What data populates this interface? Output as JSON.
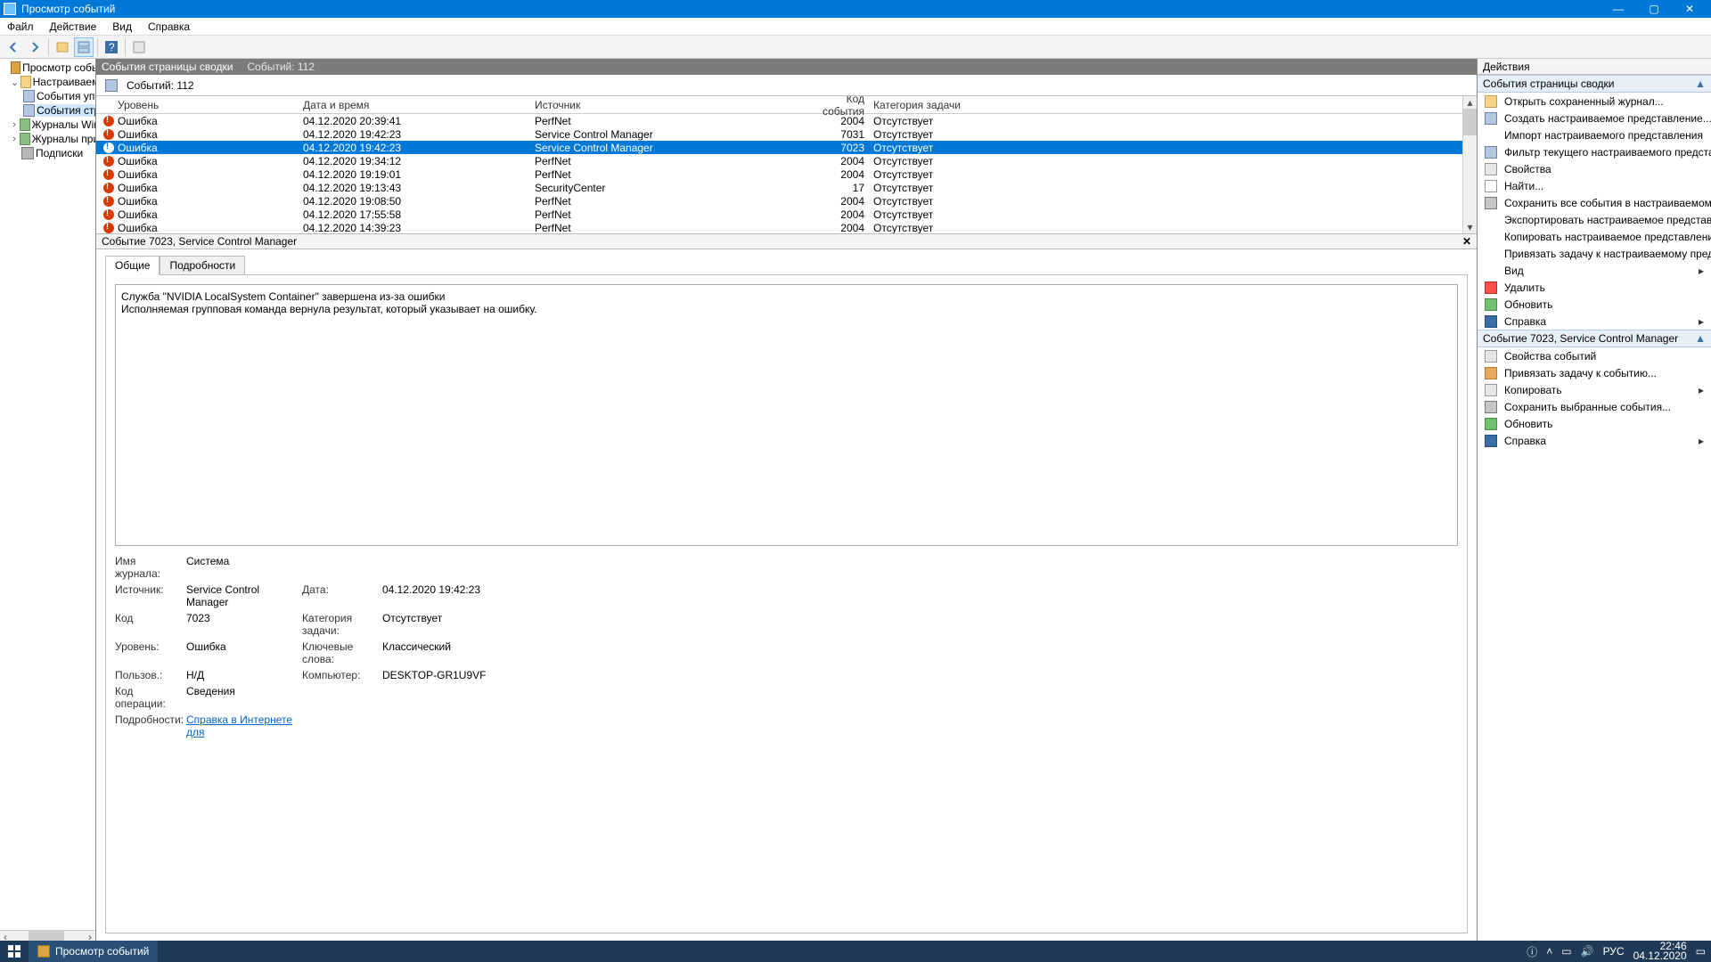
{
  "window": {
    "title": "Просмотр событий"
  },
  "menu": {
    "file": "Файл",
    "action": "Действие",
    "view": "Вид",
    "help": "Справка"
  },
  "tree": {
    "root": "Просмотр событий",
    "custom": "Настраиваемые",
    "admin_events": "События упр",
    "summary_page": "События стр",
    "windows_logs": "Журналы Windo",
    "app_logs": "Журналы прило",
    "subs": "Подписки"
  },
  "center": {
    "title": "События страницы сводки",
    "count_label": "Событий: 112",
    "count_label2": "Событий: 112"
  },
  "columns": {
    "level": "Уровень",
    "datetime": "Дата и время",
    "source": "Источник",
    "code": "Код события",
    "category": "Категория задачи"
  },
  "rows": [
    {
      "level": "Ошибка",
      "dt": "04.12.2020 20:39:41",
      "src": "PerfNet",
      "code": "2004",
      "cat": "Отсутствует",
      "sel": false
    },
    {
      "level": "Ошибка",
      "dt": "04.12.2020 19:42:23",
      "src": "Service Control Manager",
      "code": "7031",
      "cat": "Отсутствует",
      "sel": false
    },
    {
      "level": "Ошибка",
      "dt": "04.12.2020 19:42:23",
      "src": "Service Control Manager",
      "code": "7023",
      "cat": "Отсутствует",
      "sel": true
    },
    {
      "level": "Ошибка",
      "dt": "04.12.2020 19:34:12",
      "src": "PerfNet",
      "code": "2004",
      "cat": "Отсутствует",
      "sel": false
    },
    {
      "level": "Ошибка",
      "dt": "04.12.2020 19:19:01",
      "src": "PerfNet",
      "code": "2004",
      "cat": "Отсутствует",
      "sel": false
    },
    {
      "level": "Ошибка",
      "dt": "04.12.2020 19:13:43",
      "src": "SecurityCenter",
      "code": "17",
      "cat": "Отсутствует",
      "sel": false
    },
    {
      "level": "Ошибка",
      "dt": "04.12.2020 19:08:50",
      "src": "PerfNet",
      "code": "2004",
      "cat": "Отсутствует",
      "sel": false
    },
    {
      "level": "Ошибка",
      "dt": "04.12.2020 17:55:58",
      "src": "PerfNet",
      "code": "2004",
      "cat": "Отсутствует",
      "sel": false
    },
    {
      "level": "Ошибка",
      "dt": "04.12.2020 14:39:23",
      "src": "PerfNet",
      "code": "2004",
      "cat": "Отсутствует",
      "sel": false
    }
  ],
  "detail": {
    "header": "Событие 7023, Service Control Manager",
    "tab_general": "Общие",
    "tab_details": "Подробности",
    "desc_line1": "Служба \"NVIDIA LocalSystem Container\" завершена из-за ошибки",
    "desc_line2": "Исполняемая групповая команда вернула результат, который указывает на ошибку.",
    "k_log": "Имя журнала:",
    "v_log": "Система",
    "k_src": "Источник:",
    "v_src": "Service Control Manager",
    "k_date": "Дата:",
    "v_date": "04.12.2020 19:42:23",
    "k_code": "Код",
    "v_code": "7023",
    "k_cat": "Категория задачи:",
    "v_cat": "Отсутствует",
    "k_level": "Уровень:",
    "v_level": "Ошибка",
    "k_kw": "Ключевые слова:",
    "v_kw": "Классический",
    "k_user": "Пользов.:",
    "v_user": "Н/Д",
    "k_comp": "Компьютер:",
    "v_comp": "DESKTOP-GR1U9VF",
    "k_op": "Код операции:",
    "v_op": "Сведения",
    "k_more": "Подробности:",
    "v_more": "Справка в Интернете для"
  },
  "actions": {
    "title": "Действия",
    "sec1": "События страницы сводки",
    "a_open": "Открыть сохраненный журнал...",
    "a_create": "Создать настраиваемое представление...",
    "a_import": "Импорт настраиваемого представления",
    "a_filter": "Фильтр текущего настраиваемого представления...",
    "a_props": "Свойства",
    "a_find": "Найти...",
    "a_saveall": "Сохранить все события в настраиваемом представ...",
    "a_export": "Экспортировать настраиваемое представление...",
    "a_copyview": "Копировать настраиваемое представление...",
    "a_attach": "Привязать задачу к настраиваемому представлени...",
    "a_view": "Вид",
    "a_delete": "Удалить",
    "a_refresh": "Обновить",
    "a_help": "Справка",
    "sec2": "Событие 7023, Service Control Manager",
    "a_evprops": "Свойства событий",
    "a_evattach": "Привязать задачу к событию...",
    "a_copy": "Копировать",
    "a_savesel": "Сохранить выбранные события...",
    "a_refresh2": "Обновить",
    "a_help2": "Справка"
  },
  "taskbar": {
    "app": "Просмотр событий",
    "lang": "РУС",
    "time": "22:46",
    "date": "04.12.2020"
  }
}
